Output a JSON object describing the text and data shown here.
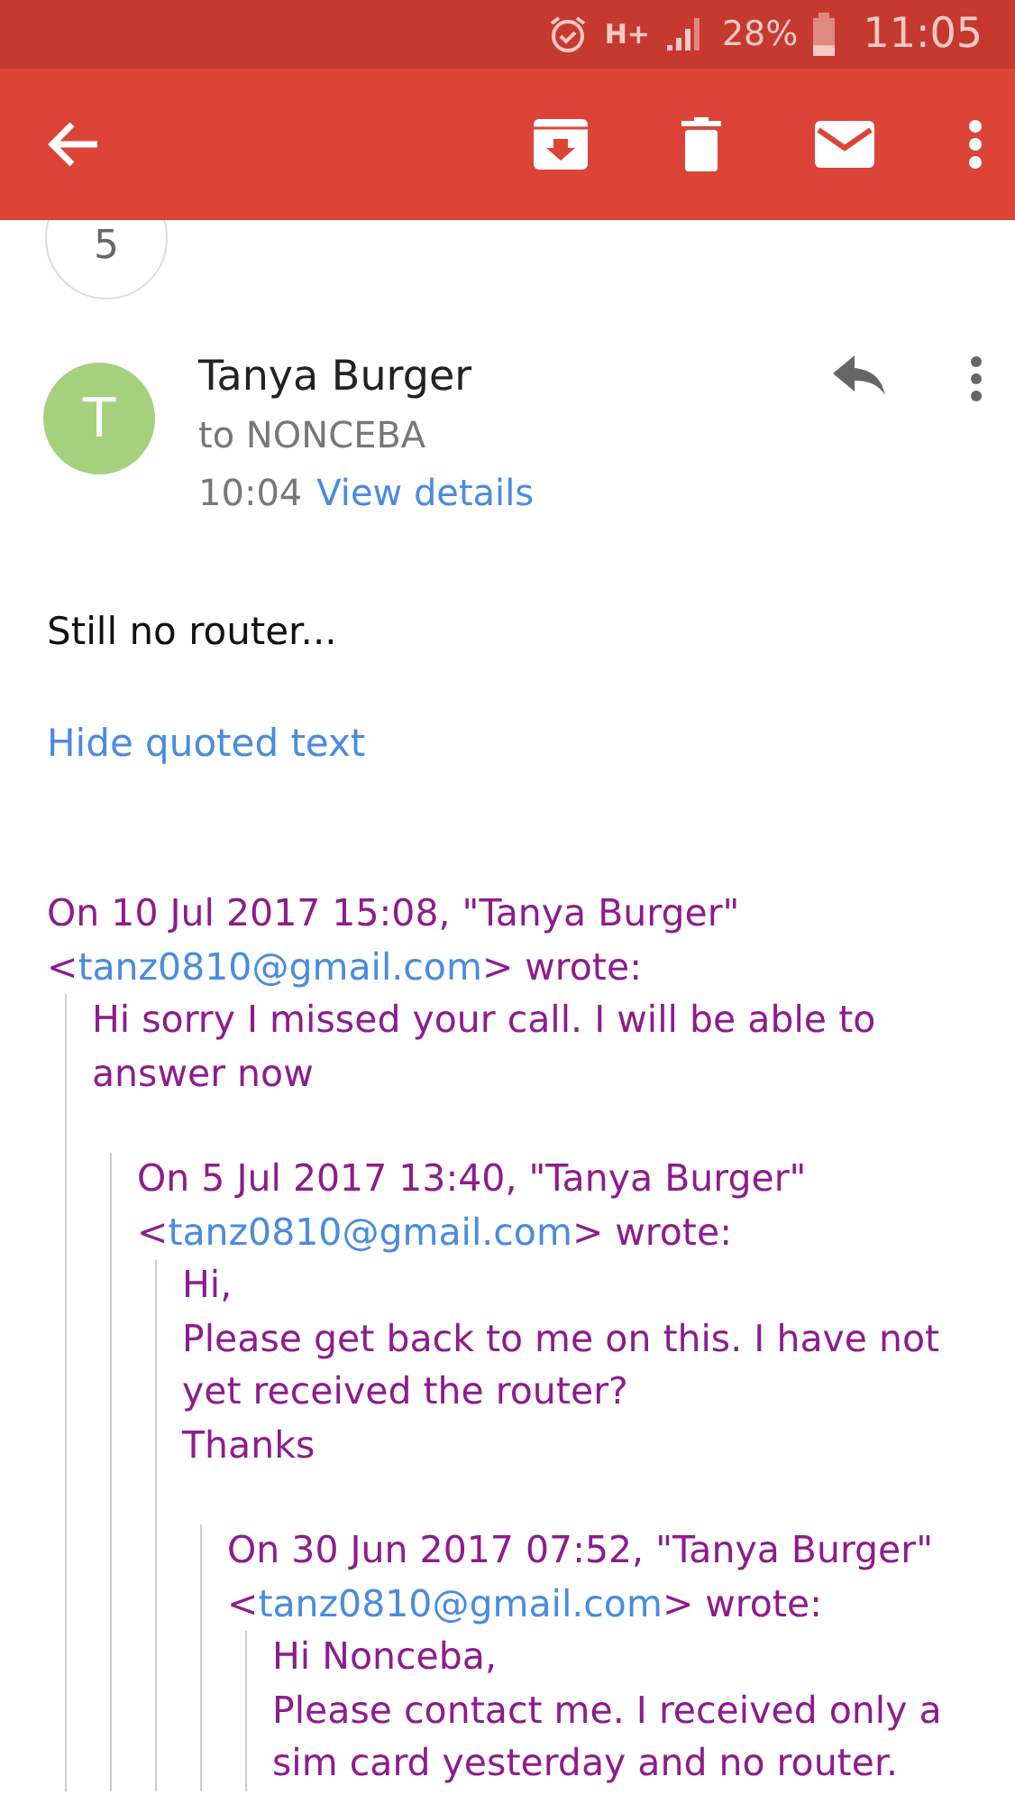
{
  "status_bar": {
    "network": "H+",
    "battery": "28%",
    "time": "11:05"
  },
  "thread_count": "5",
  "message": {
    "avatar_initial": "T",
    "sender": "Tanya Burger",
    "to": "to NONCEBA",
    "time": "10:04",
    "view_details": "View details"
  },
  "body": "Still no router...",
  "hide_quoted": "Hide quoted text",
  "quoted": {
    "header": "On 10 Jul 2017 15:08, \"Tanya Burger\"",
    "open": "<",
    "email": "tanz0810@gmail.com",
    "close": "> wrote:",
    "lines": [
      "Hi sorry I missed your call. I will be able to answer now"
    ],
    "quoted": {
      "header": "On 5 Jul 2017 13:40, \"Tanya Burger\"",
      "open": "<",
      "email": "tanz0810@gmail.com",
      "close": "> wrote:",
      "lines": [
        "Hi,",
        "Please get back to me on this. I have not yet received the router?",
        "Thanks"
      ],
      "quoted": {
        "header": "On 30 Jun 2017 07:52, \"Tanya Burger\"",
        "open": "<",
        "email": "tanz0810@gmail.com",
        "close": "> wrote:",
        "lines": [
          "Hi Nonceba,",
          "Please contact me. I received only a",
          "sim card yesterday and no router."
        ]
      }
    }
  }
}
